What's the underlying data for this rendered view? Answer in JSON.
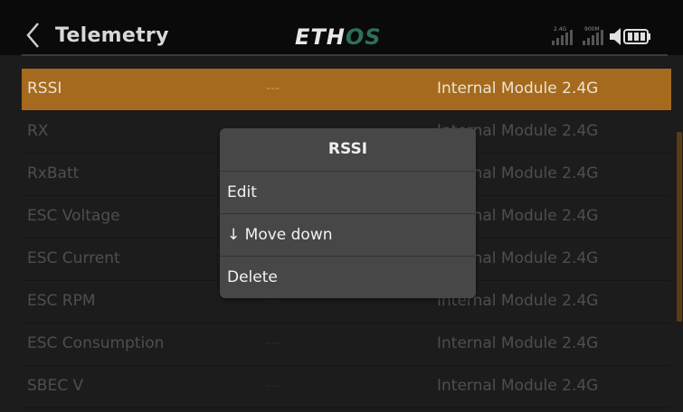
{
  "header": {
    "title": "Telemetry",
    "logo_main": "ETH",
    "logo_accent": "OS",
    "status": {
      "signal_label_1": "2.4G",
      "signal_label_2": "900M"
    }
  },
  "rows": [
    {
      "name": "RSSI",
      "value": "---",
      "source": "Internal Module 2.4G",
      "selected": true
    },
    {
      "name": "RX",
      "value": "",
      "source": "Internal Module 2.4G"
    },
    {
      "name": "RxBatt",
      "value": "",
      "source": "Internal Module 2.4G"
    },
    {
      "name": "ESC Voltage",
      "value": "",
      "source": "Internal Module 2.4G"
    },
    {
      "name": "ESC Current",
      "value": "",
      "source": "Internal Module 2.4G"
    },
    {
      "name": "ESC RPM",
      "value": "---",
      "source": "Internal Module 2.4G"
    },
    {
      "name": "ESC Consumption",
      "value": "---",
      "source": "Internal Module 2.4G"
    },
    {
      "name": "SBEC V",
      "value": "---",
      "source": "Internal Module 2.4G"
    }
  ],
  "popup": {
    "title": "RSSI",
    "items": [
      "Edit",
      "↓ Move down",
      "Delete"
    ]
  },
  "colors": {
    "accent": "#a56a1e",
    "background": "#1c1c1c",
    "popup": "#474747"
  }
}
